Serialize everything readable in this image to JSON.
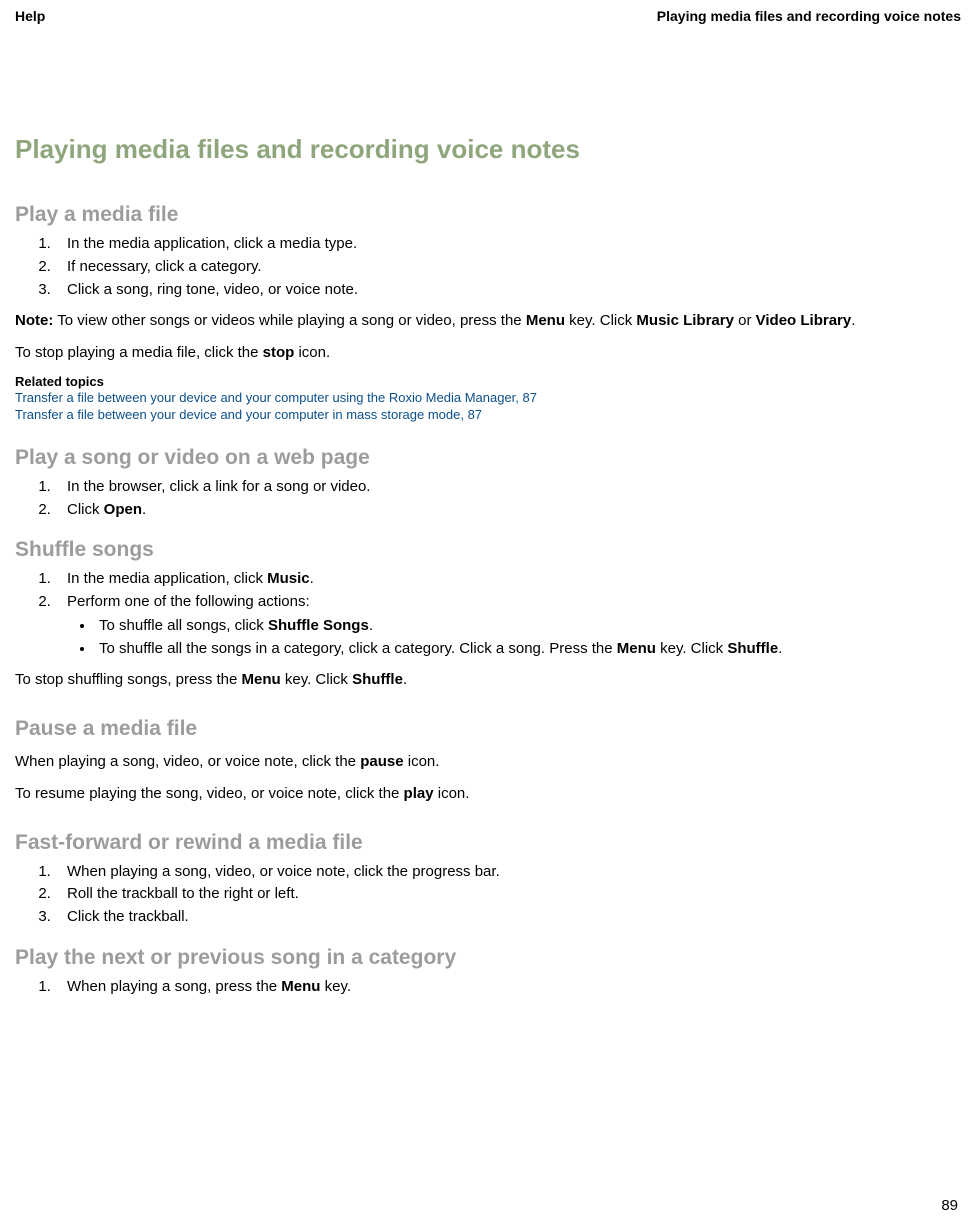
{
  "header": {
    "left": "Help",
    "right": "Playing media files and recording voice notes"
  },
  "title": "Playing media files and recording voice notes",
  "s1": {
    "heading": "Play a media file",
    "step1": "In the media application, click a media type.",
    "step2": "If necessary, click a category.",
    "step3": "Click a song, ring tone, video, or voice note.",
    "note_label": "Note:",
    "note_text_a": "  To view other songs or videos while playing a song or video, press the ",
    "note_menu": "Menu",
    "note_text_b": " key. Click ",
    "note_ml": "Music Library",
    "note_or": " or ",
    "note_vl": "Video Library",
    "note_end": ".",
    "stop_a": "To stop playing a media file, click the ",
    "stop_b": "stop",
    "stop_c": " icon.",
    "related_label": "Related topics",
    "link1": "Transfer a file between your device and your computer using the Roxio Media Manager, 87",
    "link2": "Transfer a file between your device and your computer in mass storage mode, 87"
  },
  "s2": {
    "heading": "Play a song or video on a web page",
    "step1": "In the browser, click a link for a song or video.",
    "step2_a": "Click ",
    "step2_b": "Open",
    "step2_c": "."
  },
  "s3": {
    "heading": "Shuffle songs",
    "step1_a": "In the media application, click ",
    "step1_b": "Music",
    "step1_c": ".",
    "step2": "Perform one of the following actions:",
    "b1_a": "To shuffle all songs, click ",
    "b1_b": "Shuffle Songs",
    "b1_c": ".",
    "b2_a": "To shuffle all the songs in a category, click a category. Click a song. Press the ",
    "b2_b": "Menu",
    "b2_c": " key. Click ",
    "b2_d": "Shuffle",
    "b2_e": ".",
    "stop_a": "To stop shuffling songs, press the ",
    "stop_b": "Menu",
    "stop_c": " key. Click ",
    "stop_d": "Shuffle",
    "stop_e": "."
  },
  "s4": {
    "heading": "Pause a media file",
    "p1_a": "When playing a song, video, or voice note, click the ",
    "p1_b": "pause",
    "p1_c": " icon.",
    "p2_a": "To resume playing the song, video, or voice note, click the ",
    "p2_b": "play",
    "p2_c": " icon."
  },
  "s5": {
    "heading": "Fast-forward or rewind a media file",
    "step1": "When playing a song, video, or voice note, click the progress bar.",
    "step2": "Roll the trackball to the right or left.",
    "step3": "Click the trackball."
  },
  "s6": {
    "heading": "Play the next or previous song in a category",
    "step1_a": "When playing a song, press the ",
    "step1_b": "Menu",
    "step1_c": " key."
  },
  "page_number": "89"
}
